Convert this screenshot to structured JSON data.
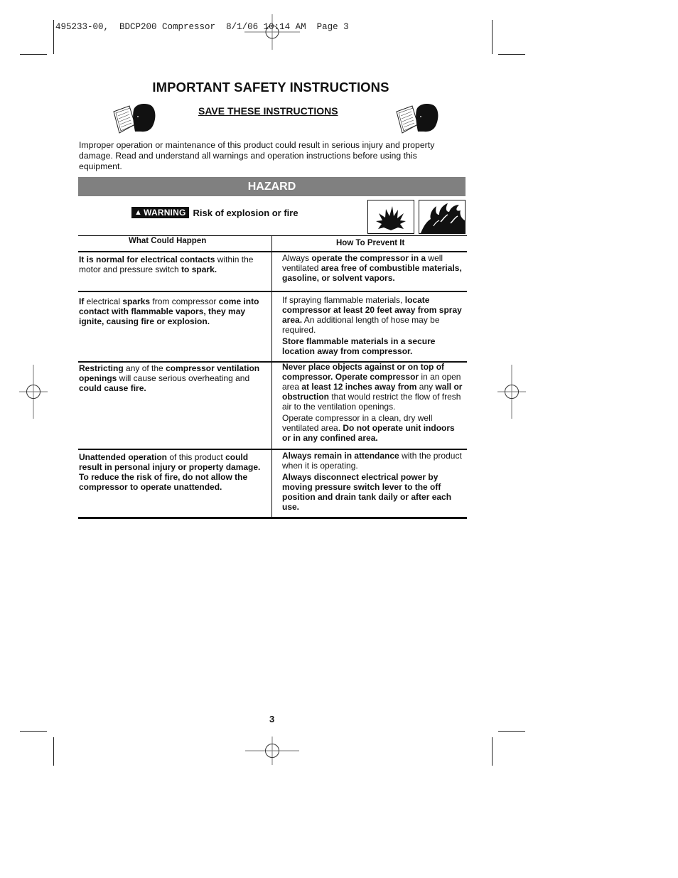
{
  "slug": {
    "job": "495233-00,",
    "product": "BDCP200 Compressor",
    "date": "8/1/06",
    "time": "10:14 AM",
    "page": "Page 3"
  },
  "title": "IMPORTANT SAFETY INSTRUCTIONS",
  "subtitle": "SAVE THESE INSTRUCTIONS",
  "intro": "Improper operation or maintenance of this product could result in serious injury and property damage. Read and understand all warnings and operation instructions before using this equipment.",
  "hazard_label": "HAZARD",
  "warning": {
    "badge": "WARNING",
    "badge_icon": "alert-triangle-icon",
    "text": "Risk of explosion or fire",
    "pictograms": [
      "explosion-icon",
      "fire-icon"
    ]
  },
  "table": {
    "headers": [
      "What Could Happen",
      "How To Prevent It"
    ],
    "rows": [
      {
        "happen": [
          [
            {
              "t": "It is normal for electrical contacts",
              "b": true
            },
            {
              "t": " within the motor and pressure switch ",
              "b": false
            },
            {
              "t": "to spark.",
              "b": true
            }
          ]
        ],
        "prevent": [
          [
            {
              "t": "Always ",
              "b": false
            },
            {
              "t": "operate the compressor in a",
              "b": true
            },
            {
              "t": " well ventilated ",
              "b": false
            },
            {
              "t": "area free of combustible materials, gasoline, or solvent vapors.",
              "b": true
            }
          ]
        ]
      },
      {
        "happen": [
          [
            {
              "t": "If",
              "b": true
            },
            {
              "t": " electrical ",
              "b": false
            },
            {
              "t": "sparks",
              "b": true
            },
            {
              "t": " from compressor ",
              "b": false
            },
            {
              "t": "come into contact with flammable vapors, they may ignite, causing fire or explosion.",
              "b": true
            }
          ]
        ],
        "prevent": [
          [
            {
              "t": "If spraying flammable materials, ",
              "b": false
            },
            {
              "t": "locate compressor at least 20 feet away from spray area.",
              "b": true
            },
            {
              "t": " An additional length of hose may be required.",
              "b": false
            }
          ],
          [
            {
              "t": "Store flammable materials in a secure location away from compressor.",
              "b": true
            }
          ]
        ]
      },
      {
        "happen": [
          [
            {
              "t": "Restricting",
              "b": true
            },
            {
              "t": " any of the ",
              "b": false
            },
            {
              "t": "compressor ventilation openings",
              "b": true
            },
            {
              "t": " will cause serious overheating and ",
              "b": false
            },
            {
              "t": "could cause fire.",
              "b": true
            }
          ]
        ],
        "prevent": [
          [
            {
              "t": "Never place objects against or on top of compressor. Operate compressor",
              "b": true
            },
            {
              "t": " in an open area ",
              "b": false
            },
            {
              "t": "at least 12 inches away from",
              "b": true
            },
            {
              "t": " any ",
              "b": false
            },
            {
              "t": "wall or obstruction",
              "b": true
            },
            {
              "t": " that would restrict the flow of fresh air to  the ventilation openings.",
              "b": false
            }
          ],
          [
            {
              "t": "Operate compressor in a clean, dry well ventilated area. ",
              "b": false
            },
            {
              "t": "Do not operate unit indoors or in any confined area.",
              "b": true
            }
          ]
        ]
      },
      {
        "happen": [
          [
            {
              "t": "Unattended operation",
              "b": true
            },
            {
              "t": " of this product ",
              "b": false
            },
            {
              "t": "could result in personal injury or property damage. To reduce the risk of fire, do not allow the compressor to operate unattended.",
              "b": true
            }
          ]
        ],
        "prevent": [
          [
            {
              "t": "Always remain in attendance",
              "b": true
            },
            {
              "t": " with the product when it is operating.",
              "b": false
            }
          ],
          [
            {
              "t": "Always disconnect electrical power by moving pressure switch lever to the off position and drain tank daily or after each use.",
              "b": true
            }
          ]
        ]
      }
    ]
  },
  "page_number": "3"
}
